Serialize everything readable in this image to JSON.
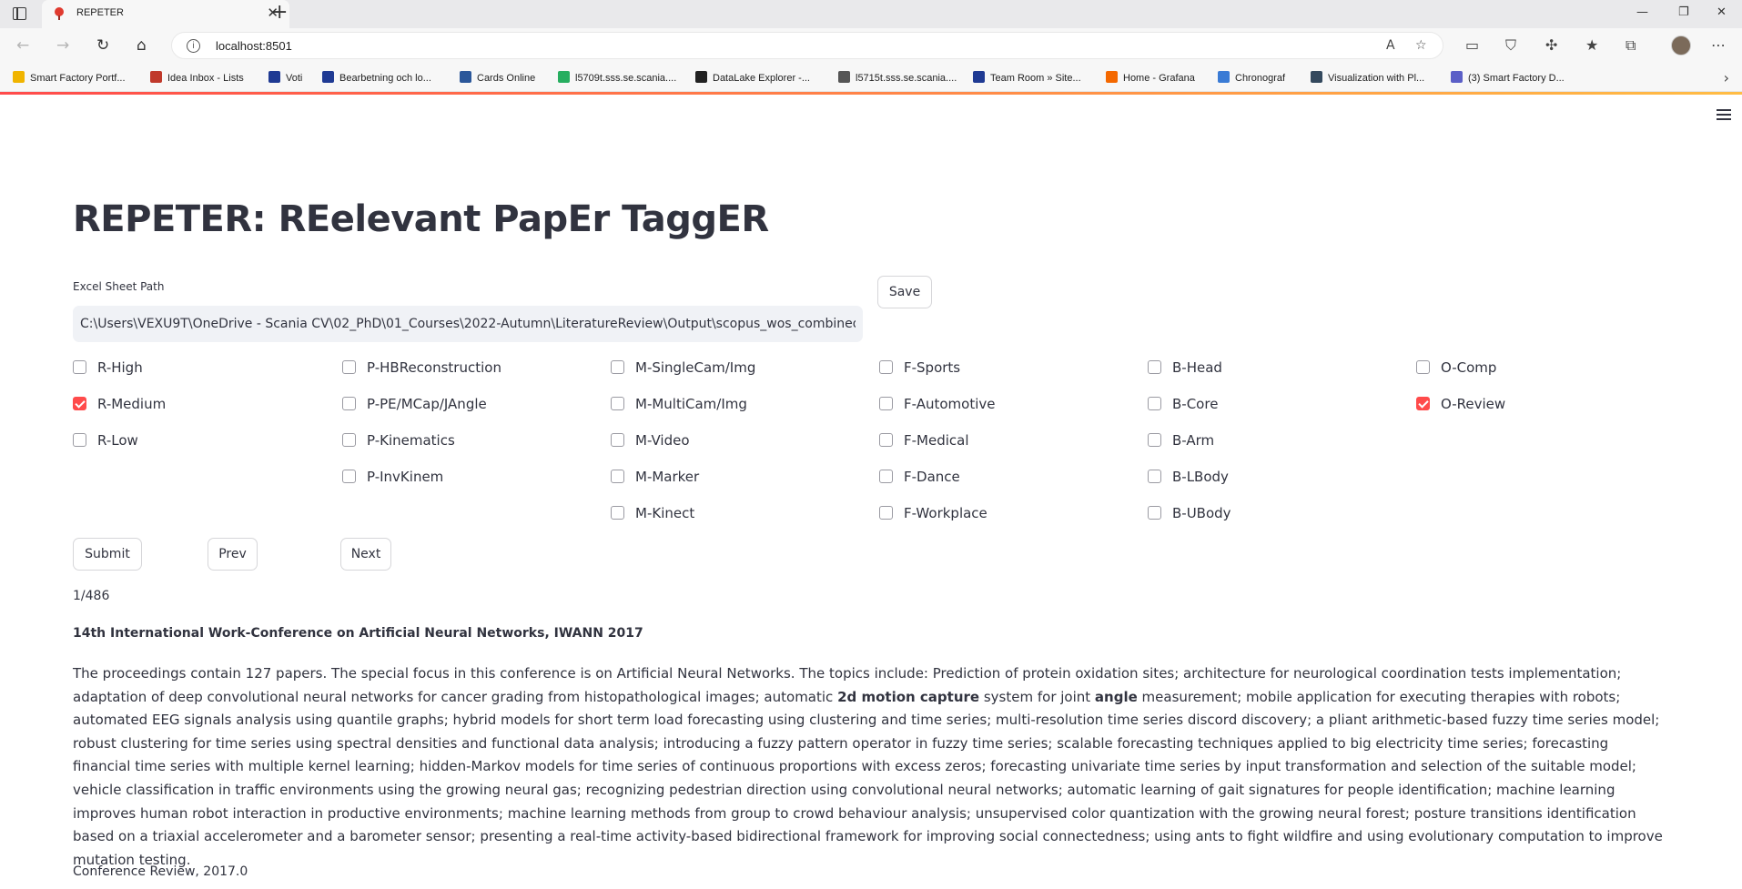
{
  "browser": {
    "tab_title": "REPETER",
    "url": "localhost:8501",
    "bookmarks": [
      {
        "label": "Smart Factory Portf...",
        "color": "#f0b400"
      },
      {
        "label": "Idea Inbox - Lists",
        "color": "#c0392b"
      },
      {
        "label": "Voti",
        "color": "#1f3a93"
      },
      {
        "label": "Bearbetning och lo...",
        "color": "#1f3a93"
      },
      {
        "label": "Cards Online",
        "color": "#2b579a"
      },
      {
        "label": "l5709t.sss.se.scania....",
        "color": "#27ae60"
      },
      {
        "label": "DataLake Explorer -...",
        "color": "#222222"
      },
      {
        "label": "l5715t.sss.se.scania....",
        "color": "#555555"
      },
      {
        "label": "Team Room » Site...",
        "color": "#1f3a93"
      },
      {
        "label": "Home - Grafana",
        "color": "#f46800"
      },
      {
        "label": "Chronograf",
        "color": "#3a7bd5"
      },
      {
        "label": "Visualization with Pl...",
        "color": "#34495e"
      },
      {
        "label": "(3) Smart Factory D...",
        "color": "#5b5fc7"
      }
    ]
  },
  "app": {
    "title": "REPETER: REelevant PapEr TaggER",
    "path_field": {
      "label": "Excel Sheet Path",
      "value": "C:\\Users\\VEXU9T\\OneDrive - Scania CV\\02_PhD\\01_Courses\\2022-Autumn\\LiteratureReview\\Output\\scopus_wos_combined.xlsx"
    },
    "save_label": "Save",
    "tag_columns": [
      [
        {
          "label": "R-High",
          "checked": false
        },
        {
          "label": "R-Medium",
          "checked": true
        },
        {
          "label": "R-Low",
          "checked": false
        }
      ],
      [
        {
          "label": "P-HBReconstruction",
          "checked": false
        },
        {
          "label": "P-PE/MCap/JAngle",
          "checked": false
        },
        {
          "label": "P-Kinematics",
          "checked": false
        },
        {
          "label": "P-InvKinem",
          "checked": false
        }
      ],
      [
        {
          "label": "M-SingleCam/Img",
          "checked": false
        },
        {
          "label": "M-MultiCam/Img",
          "checked": false
        },
        {
          "label": "M-Video",
          "checked": false
        },
        {
          "label": "M-Marker",
          "checked": false
        },
        {
          "label": "M-Kinect",
          "checked": false
        }
      ],
      [
        {
          "label": "F-Sports",
          "checked": false
        },
        {
          "label": "F-Automotive",
          "checked": false
        },
        {
          "label": "F-Medical",
          "checked": false
        },
        {
          "label": "F-Dance",
          "checked": false
        },
        {
          "label": "F-Workplace",
          "checked": false
        }
      ],
      [
        {
          "label": "B-Head",
          "checked": false
        },
        {
          "label": "B-Core",
          "checked": false
        },
        {
          "label": "B-Arm",
          "checked": false
        },
        {
          "label": "B-LBody",
          "checked": false
        },
        {
          "label": "B-UBody",
          "checked": false
        }
      ],
      [
        {
          "label": "O-Comp",
          "checked": false
        },
        {
          "label": "O-Review",
          "checked": true
        }
      ]
    ],
    "buttons": {
      "submit": "Submit",
      "prev": "Prev",
      "next": "Next"
    },
    "counter": "1/486",
    "paper": {
      "title": "14th International Work-Conference on Artificial Neural Networks, IWANN 2017",
      "abstract_parts": [
        {
          "text": "The proceedings contain 127 papers. The special focus in this conference is on Artificial Neural Networks. The topics include: Prediction of protein oxidation sites; architecture for neurological coordination tests implementation; adaptation of deep convolutional neural networks for cancer grading from histopathological images; automatic ",
          "bold": false
        },
        {
          "text": "2d motion capture",
          "bold": true
        },
        {
          "text": " system for joint ",
          "bold": false
        },
        {
          "text": "angle",
          "bold": true
        },
        {
          "text": " measurement; mobile application for executing therapies with robots; automated EEG signals analysis using quantile graphs; hybrid models for short term load forecasting using clustering and time series; multi-resolution time series discord discovery; a pliant arithmetic-based fuzzy time series model; robust clustering for time series using spectral densities and functional data analysis; introducing a fuzzy pattern operator in fuzzy time series; scalable forecasting techniques applied to big electricity time series; forecasting financial time series with multiple kernel learning; hidden-Markov models for time series of continuous proportions with excess zeros; forecasting univariate time series by input transformation and selection of the suitable model; vehicle classification in traffic environments using the growing neural gas; recognizing pedestrian direction using convolutional neural networks; automatic learning of gait signatures for people identification; machine learning improves human robot interaction in productive environments; machine learning methods from group to crowd behaviour analysis; unsupervised color quantization with the growing neural forest; posture transitions identification based on a triaxial accelerometer and a barometer sensor; presenting a real-time activity-based bidirectional framework for improving social connectedness; using ants to fight wildfire and using evolutionary computation to improve mutation testing.",
          "bold": false
        }
      ],
      "meta": "Conference Review, 2017.0"
    },
    "accent_color": "#ff4b4b"
  }
}
